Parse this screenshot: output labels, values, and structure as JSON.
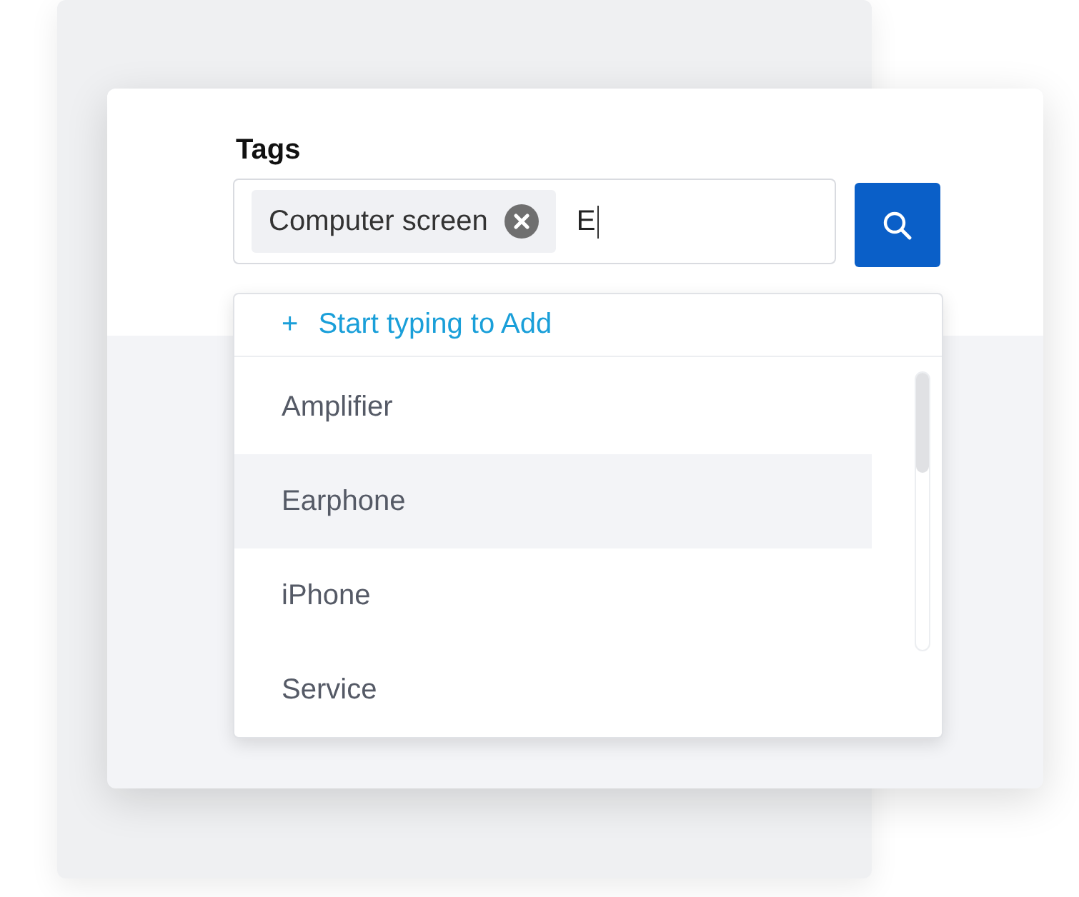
{
  "tags_field": {
    "label": "Tags",
    "chips": [
      {
        "text": "Computer screen"
      }
    ],
    "value": "E"
  },
  "dropdown": {
    "add_hint": {
      "icon": "+",
      "text": "Start typing to Add"
    },
    "items": [
      {
        "text": "Amplifier",
        "selected": false
      },
      {
        "text": "Earphone",
        "selected": true
      },
      {
        "text": "iPhone",
        "selected": false
      },
      {
        "text": "Service",
        "selected": false
      }
    ]
  }
}
